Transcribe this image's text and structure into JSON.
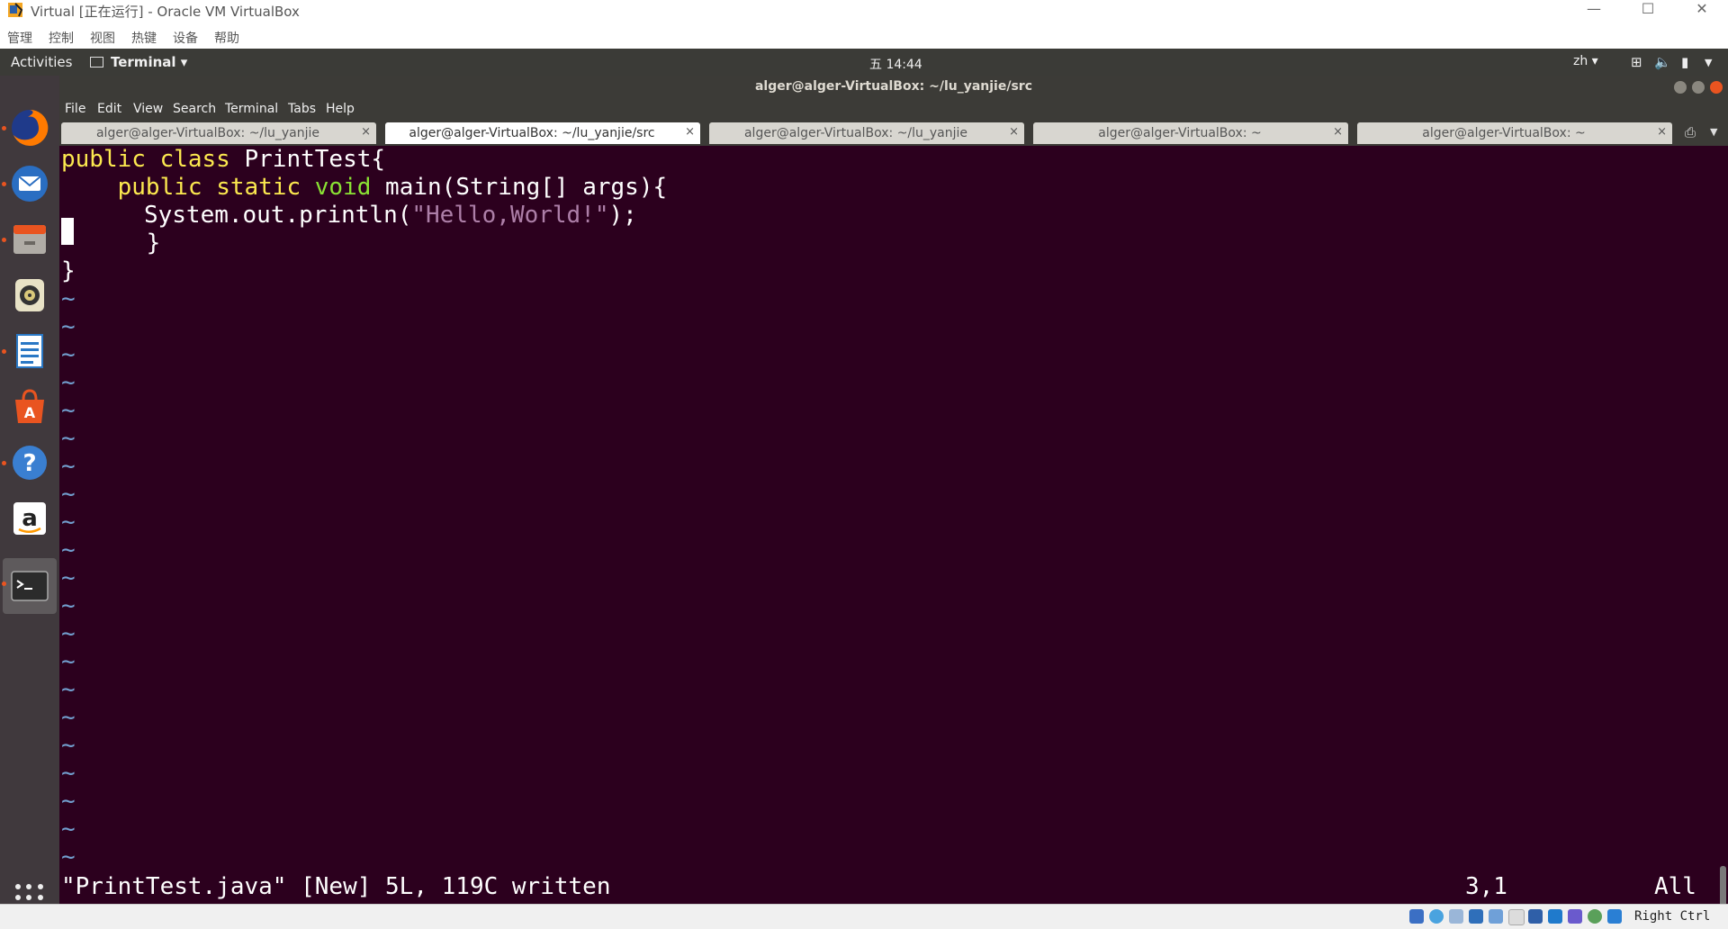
{
  "vbox": {
    "window_title": "Virtual [正在运行] - Oracle VM VirtualBox",
    "menus": [
      "管理",
      "控制",
      "视图",
      "热键",
      "设备",
      "帮助"
    ],
    "controls": {
      "minimize": "—",
      "maximize": "☐",
      "close": "✕"
    },
    "host_key": "Right Ctrl"
  },
  "topbar": {
    "activities": "Activities",
    "app_menu": "Terminal ▾",
    "clock": "五 14:44",
    "lang": "zh ▾"
  },
  "dock": {
    "items": [
      {
        "name": "firefox-icon",
        "color": "#e66000",
        "running": true
      },
      {
        "name": "thunderbird-icon",
        "color": "#2a6ec2",
        "running": true
      },
      {
        "name": "files-icon",
        "color": "#b0aca6",
        "running": true
      },
      {
        "name": "rhythmbox-icon",
        "color": "#d9c97a",
        "running": false
      },
      {
        "name": "libreoffice-writer-icon",
        "color": "#2a78c5",
        "running": true
      },
      {
        "name": "software-center-icon",
        "color": "#e95420",
        "running": false
      },
      {
        "name": "help-icon",
        "color": "#3a7fd1",
        "running": true
      },
      {
        "name": "amazon-icon",
        "color": "#ffffff",
        "running": false
      },
      {
        "name": "terminal-icon",
        "color": "#2b2b2b",
        "running": true
      }
    ]
  },
  "terminal": {
    "title": "alger@alger-VirtualBox: ~/lu_yanjie/src",
    "menus": [
      "File",
      "Edit",
      "View",
      "Search",
      "Terminal",
      "Tabs",
      "Help"
    ],
    "tabs": [
      {
        "label": "alger@alger-VirtualBox: ~/lu_yanjie",
        "active": false
      },
      {
        "label": "alger@alger-VirtualBox: ~/lu_yanjie/src",
        "active": true
      },
      {
        "label": "alger@alger-VirtualBox: ~/lu_yanjie",
        "active": false
      },
      {
        "label": "alger@alger-VirtualBox: ~",
        "active": false
      },
      {
        "label": "alger@alger-VirtualBox: ~",
        "active": false
      }
    ],
    "tab_close": "×",
    "code": {
      "l1_kw": "public class",
      "l1_rest": " PrintTest{",
      "l2_indent": "    ",
      "l2_kw": "public static",
      "l2_sp": " ",
      "l2_type": "void",
      "l2_rest": " main(String[] args){",
      "l3_pre": "   System.out.println(",
      "l3_str": "\"Hello,World!\"",
      "l3_post": ");",
      "l4": "    }",
      "l5": "}"
    },
    "tilde": "~",
    "status_message": "\"PrintTest.java\" [New] 5L, 119C written",
    "cursor_position": "3,1",
    "scroll_position": "All"
  }
}
